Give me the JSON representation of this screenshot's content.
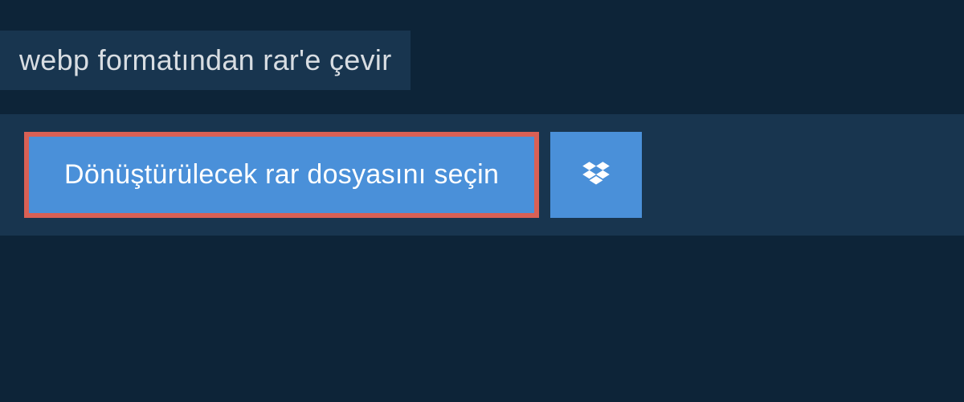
{
  "header": {
    "title": "webp formatından rar'e çevir"
  },
  "upload": {
    "select_file_label": "Dönüştürülecek rar dosyasını seçin",
    "dropbox_icon": "dropbox-icon"
  },
  "colors": {
    "background_dark": "#0d2438",
    "panel": "#18354f",
    "button_blue": "#4a90d9",
    "highlight_border": "#d96055"
  }
}
